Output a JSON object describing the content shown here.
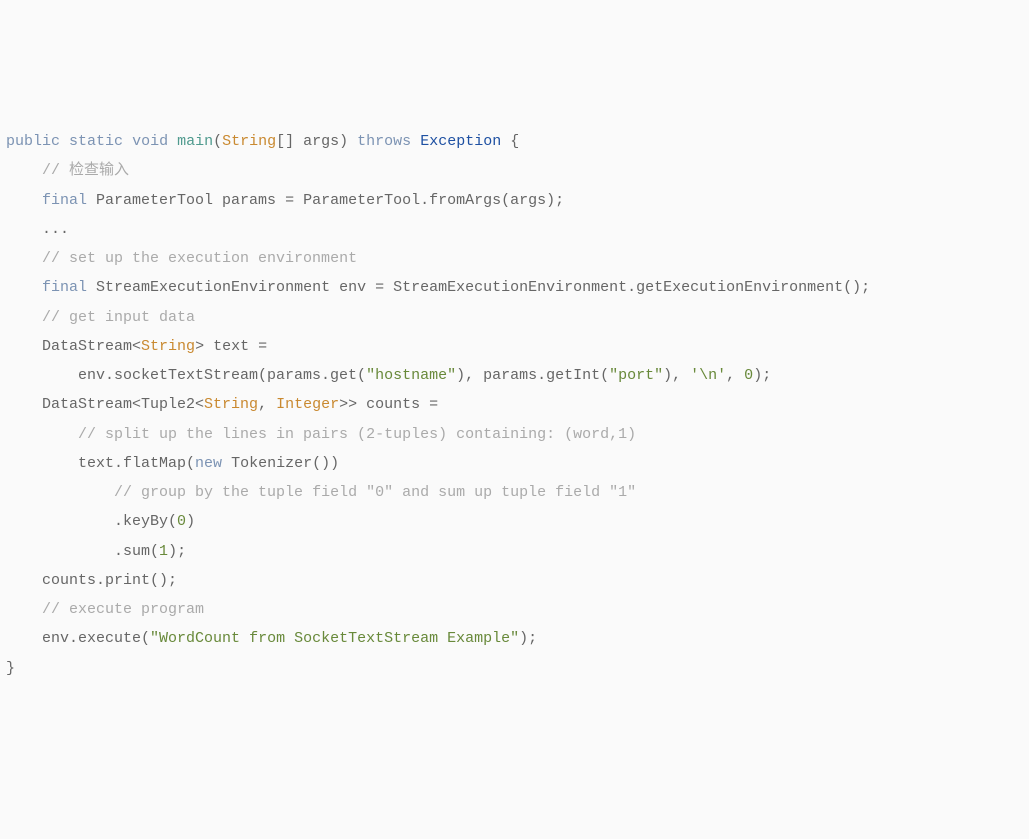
{
  "code": {
    "lines": [
      {
        "indent": 0,
        "segs": [
          {
            "c": "kw",
            "t": "public"
          },
          {
            "t": " "
          },
          {
            "c": "kw",
            "t": "static"
          },
          {
            "t": " "
          },
          {
            "c": "kw",
            "t": "void"
          },
          {
            "t": " "
          },
          {
            "c": "fn",
            "t": "main"
          },
          {
            "t": "("
          },
          {
            "c": "type",
            "t": "String"
          },
          {
            "t": "[] args) "
          },
          {
            "c": "kw",
            "t": "throws"
          },
          {
            "t": " "
          },
          {
            "c": "cls",
            "t": "Exception"
          },
          {
            "t": " {"
          }
        ]
      },
      {
        "indent": 1,
        "segs": [
          {
            "c": "cmt",
            "t": "// 检查输入"
          }
        ]
      },
      {
        "indent": 1,
        "segs": [
          {
            "c": "kw",
            "t": "final"
          },
          {
            "t": " ParameterTool params = ParameterTool.fromArgs(args);"
          }
        ]
      },
      {
        "indent": 1,
        "segs": [
          {
            "t": "..."
          }
        ]
      },
      {
        "indent": 0,
        "segs": [
          {
            "t": ""
          }
        ]
      },
      {
        "indent": 1,
        "segs": [
          {
            "c": "cmt",
            "t": "// set up the execution environment"
          }
        ]
      },
      {
        "indent": 1,
        "segs": [
          {
            "c": "kw",
            "t": "final"
          },
          {
            "t": " StreamExecutionEnvironment env = StreamExecutionEnvironment.getExecutionEnvironment();"
          }
        ]
      },
      {
        "indent": 0,
        "segs": [
          {
            "t": ""
          }
        ]
      },
      {
        "indent": 1,
        "segs": [
          {
            "c": "cmt",
            "t": "// get input data"
          }
        ]
      },
      {
        "indent": 1,
        "segs": [
          {
            "t": "DataStream<"
          },
          {
            "c": "type",
            "t": "String"
          },
          {
            "t": "> text ="
          }
        ]
      },
      {
        "indent": 2,
        "segs": [
          {
            "t": "env.socketTextStream(params.get("
          },
          {
            "c": "str",
            "t": "\"hostname\""
          },
          {
            "t": "), params.getInt("
          },
          {
            "c": "str",
            "t": "\"port\""
          },
          {
            "t": "), "
          },
          {
            "c": "chr",
            "t": "'\\n'"
          },
          {
            "t": ", "
          },
          {
            "c": "num",
            "t": "0"
          },
          {
            "t": ");"
          }
        ]
      },
      {
        "indent": 0,
        "segs": [
          {
            "t": ""
          }
        ]
      },
      {
        "indent": 1,
        "segs": [
          {
            "t": "DataStream<Tuple2<"
          },
          {
            "c": "type",
            "t": "String"
          },
          {
            "t": ", "
          },
          {
            "c": "type",
            "t": "Integer"
          },
          {
            "t": ">> counts ="
          }
        ]
      },
      {
        "indent": 2,
        "segs": [
          {
            "c": "cmt",
            "t": "// split up the lines in pairs (2-tuples) containing: (word,1)"
          }
        ]
      },
      {
        "indent": 2,
        "segs": [
          {
            "t": "text.flatMap("
          },
          {
            "c": "kw",
            "t": "new"
          },
          {
            "t": " Tokenizer())"
          }
        ]
      },
      {
        "indent": 3,
        "segs": [
          {
            "c": "cmt",
            "t": "// group by the tuple field \"0\" and sum up tuple field \"1\""
          }
        ]
      },
      {
        "indent": 3,
        "segs": [
          {
            "t": ".keyBy("
          },
          {
            "c": "num",
            "t": "0"
          },
          {
            "t": ")"
          }
        ]
      },
      {
        "indent": 3,
        "segs": [
          {
            "t": ".sum("
          },
          {
            "c": "num",
            "t": "1"
          },
          {
            "t": ");"
          }
        ]
      },
      {
        "indent": 1,
        "segs": [
          {
            "t": "counts.print();"
          }
        ]
      },
      {
        "indent": 0,
        "segs": [
          {
            "t": ""
          }
        ]
      },
      {
        "indent": 1,
        "segs": [
          {
            "c": "cmt",
            "t": "// execute program"
          }
        ]
      },
      {
        "indent": 1,
        "segs": [
          {
            "t": "env.execute("
          },
          {
            "c": "str",
            "t": "\"WordCount from SocketTextStream Example\""
          },
          {
            "t": ");"
          }
        ]
      },
      {
        "indent": 0,
        "segs": [
          {
            "t": "}"
          }
        ]
      }
    ],
    "indentUnit": "    "
  }
}
